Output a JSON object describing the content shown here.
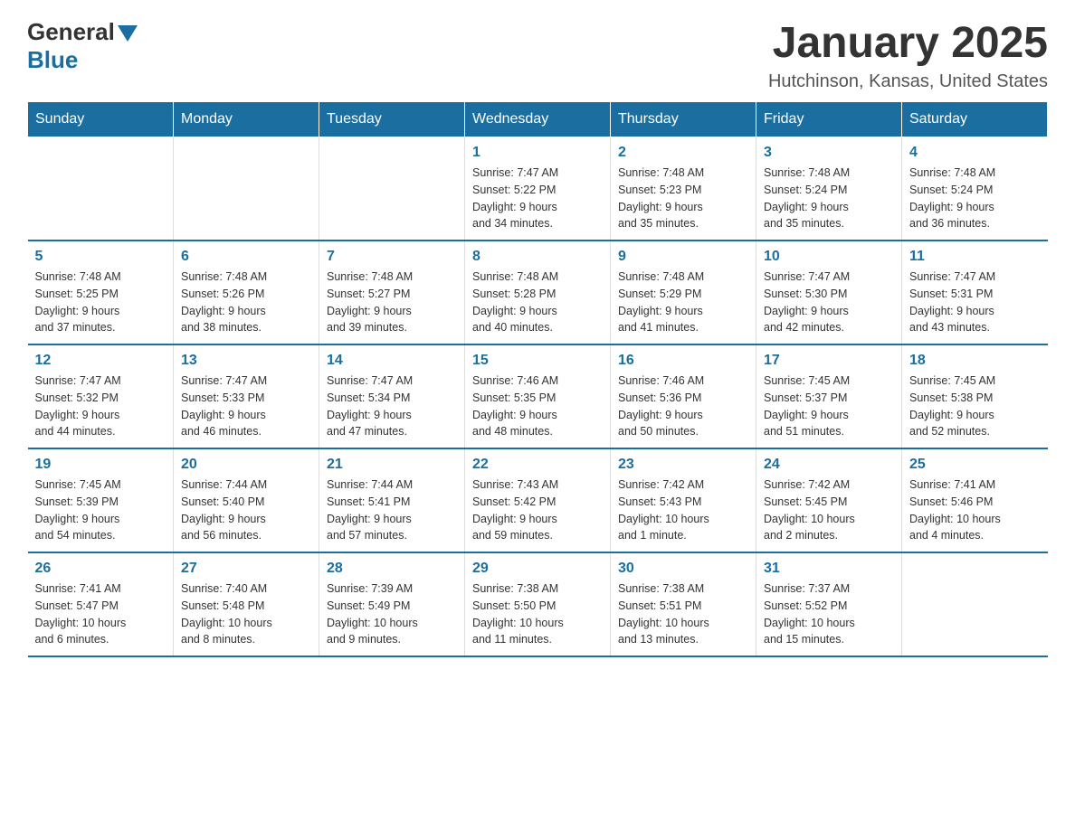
{
  "logo": {
    "general": "General",
    "blue": "Blue"
  },
  "header": {
    "month": "January 2025",
    "location": "Hutchinson, Kansas, United States"
  },
  "weekdays": [
    "Sunday",
    "Monday",
    "Tuesday",
    "Wednesday",
    "Thursday",
    "Friday",
    "Saturday"
  ],
  "weeks": [
    [
      {
        "day": "",
        "info": ""
      },
      {
        "day": "",
        "info": ""
      },
      {
        "day": "",
        "info": ""
      },
      {
        "day": "1",
        "info": "Sunrise: 7:47 AM\nSunset: 5:22 PM\nDaylight: 9 hours\nand 34 minutes."
      },
      {
        "day": "2",
        "info": "Sunrise: 7:48 AM\nSunset: 5:23 PM\nDaylight: 9 hours\nand 35 minutes."
      },
      {
        "day": "3",
        "info": "Sunrise: 7:48 AM\nSunset: 5:24 PM\nDaylight: 9 hours\nand 35 minutes."
      },
      {
        "day": "4",
        "info": "Sunrise: 7:48 AM\nSunset: 5:24 PM\nDaylight: 9 hours\nand 36 minutes."
      }
    ],
    [
      {
        "day": "5",
        "info": "Sunrise: 7:48 AM\nSunset: 5:25 PM\nDaylight: 9 hours\nand 37 minutes."
      },
      {
        "day": "6",
        "info": "Sunrise: 7:48 AM\nSunset: 5:26 PM\nDaylight: 9 hours\nand 38 minutes."
      },
      {
        "day": "7",
        "info": "Sunrise: 7:48 AM\nSunset: 5:27 PM\nDaylight: 9 hours\nand 39 minutes."
      },
      {
        "day": "8",
        "info": "Sunrise: 7:48 AM\nSunset: 5:28 PM\nDaylight: 9 hours\nand 40 minutes."
      },
      {
        "day": "9",
        "info": "Sunrise: 7:48 AM\nSunset: 5:29 PM\nDaylight: 9 hours\nand 41 minutes."
      },
      {
        "day": "10",
        "info": "Sunrise: 7:47 AM\nSunset: 5:30 PM\nDaylight: 9 hours\nand 42 minutes."
      },
      {
        "day": "11",
        "info": "Sunrise: 7:47 AM\nSunset: 5:31 PM\nDaylight: 9 hours\nand 43 minutes."
      }
    ],
    [
      {
        "day": "12",
        "info": "Sunrise: 7:47 AM\nSunset: 5:32 PM\nDaylight: 9 hours\nand 44 minutes."
      },
      {
        "day": "13",
        "info": "Sunrise: 7:47 AM\nSunset: 5:33 PM\nDaylight: 9 hours\nand 46 minutes."
      },
      {
        "day": "14",
        "info": "Sunrise: 7:47 AM\nSunset: 5:34 PM\nDaylight: 9 hours\nand 47 minutes."
      },
      {
        "day": "15",
        "info": "Sunrise: 7:46 AM\nSunset: 5:35 PM\nDaylight: 9 hours\nand 48 minutes."
      },
      {
        "day": "16",
        "info": "Sunrise: 7:46 AM\nSunset: 5:36 PM\nDaylight: 9 hours\nand 50 minutes."
      },
      {
        "day": "17",
        "info": "Sunrise: 7:45 AM\nSunset: 5:37 PM\nDaylight: 9 hours\nand 51 minutes."
      },
      {
        "day": "18",
        "info": "Sunrise: 7:45 AM\nSunset: 5:38 PM\nDaylight: 9 hours\nand 52 minutes."
      }
    ],
    [
      {
        "day": "19",
        "info": "Sunrise: 7:45 AM\nSunset: 5:39 PM\nDaylight: 9 hours\nand 54 minutes."
      },
      {
        "day": "20",
        "info": "Sunrise: 7:44 AM\nSunset: 5:40 PM\nDaylight: 9 hours\nand 56 minutes."
      },
      {
        "day": "21",
        "info": "Sunrise: 7:44 AM\nSunset: 5:41 PM\nDaylight: 9 hours\nand 57 minutes."
      },
      {
        "day": "22",
        "info": "Sunrise: 7:43 AM\nSunset: 5:42 PM\nDaylight: 9 hours\nand 59 minutes."
      },
      {
        "day": "23",
        "info": "Sunrise: 7:42 AM\nSunset: 5:43 PM\nDaylight: 10 hours\nand 1 minute."
      },
      {
        "day": "24",
        "info": "Sunrise: 7:42 AM\nSunset: 5:45 PM\nDaylight: 10 hours\nand 2 minutes."
      },
      {
        "day": "25",
        "info": "Sunrise: 7:41 AM\nSunset: 5:46 PM\nDaylight: 10 hours\nand 4 minutes."
      }
    ],
    [
      {
        "day": "26",
        "info": "Sunrise: 7:41 AM\nSunset: 5:47 PM\nDaylight: 10 hours\nand 6 minutes."
      },
      {
        "day": "27",
        "info": "Sunrise: 7:40 AM\nSunset: 5:48 PM\nDaylight: 10 hours\nand 8 minutes."
      },
      {
        "day": "28",
        "info": "Sunrise: 7:39 AM\nSunset: 5:49 PM\nDaylight: 10 hours\nand 9 minutes."
      },
      {
        "day": "29",
        "info": "Sunrise: 7:38 AM\nSunset: 5:50 PM\nDaylight: 10 hours\nand 11 minutes."
      },
      {
        "day": "30",
        "info": "Sunrise: 7:38 AM\nSunset: 5:51 PM\nDaylight: 10 hours\nand 13 minutes."
      },
      {
        "day": "31",
        "info": "Sunrise: 7:37 AM\nSunset: 5:52 PM\nDaylight: 10 hours\nand 15 minutes."
      },
      {
        "day": "",
        "info": ""
      }
    ]
  ]
}
